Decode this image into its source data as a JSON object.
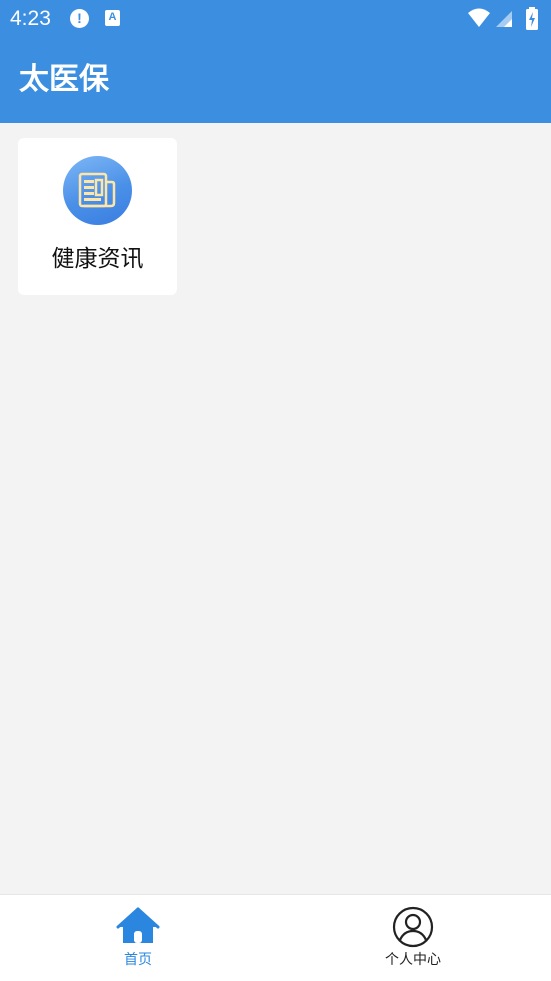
{
  "status_bar": {
    "time": "4:23",
    "alert_glyph": "!",
    "a_glyph": "A",
    "icons": [
      "alert-icon",
      "text-a-icon",
      "wifi-icon",
      "signal-icon",
      "battery-charging-icon"
    ]
  },
  "app_bar": {
    "title": "太医保"
  },
  "main": {
    "cards": [
      {
        "label": "健康资讯",
        "icon": "newspaper-icon"
      }
    ]
  },
  "bottom_nav": {
    "items": [
      {
        "label": "首页",
        "icon": "home-icon",
        "active": true
      },
      {
        "label": "个人中心",
        "icon": "user-circle-icon",
        "active": false
      }
    ]
  },
  "colors": {
    "primary": "#3c8fe0",
    "background": "#f3f3f3",
    "active_nav": "#2b86e0"
  }
}
